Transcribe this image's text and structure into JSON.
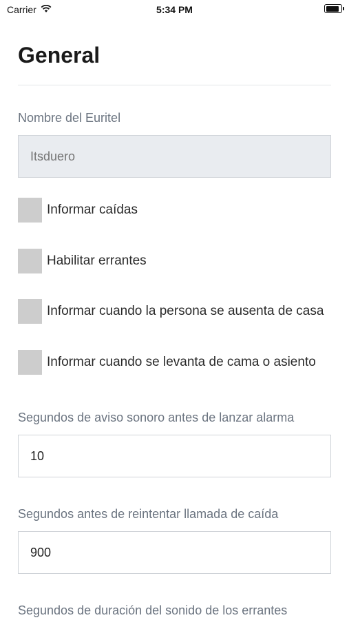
{
  "status_bar": {
    "carrier": "Carrier",
    "time": "5:34 PM",
    "wifi_icon": "wifi-icon",
    "battery_icon": "battery-icon"
  },
  "page": {
    "title": "General"
  },
  "form": {
    "device_name": {
      "label": "Nombre del Euritel",
      "placeholder": "Itsduero"
    },
    "checkboxes": [
      {
        "label": "Informar caídas",
        "checked": false
      },
      {
        "label": "Habilitar errantes",
        "checked": false
      },
      {
        "label": "Informar cuando la persona se ausenta de casa",
        "checked": false
      },
      {
        "label": "Informar cuando se levanta de cama o asiento",
        "checked": false
      }
    ],
    "alarm_delay": {
      "label": "Segundos de aviso sonoro antes de lanzar alarma",
      "value": "10"
    },
    "retry_delay": {
      "label": "Segundos antes de reintentar llamada de caída",
      "value": "900"
    },
    "wanderer_sound_duration": {
      "label": "Segundos de duración del sonido de los errantes"
    }
  },
  "colors": {
    "checkbox": "#cdcdcd",
    "disabled_input_bg": "#e9ecf0",
    "label_gray": "#6b7480"
  }
}
